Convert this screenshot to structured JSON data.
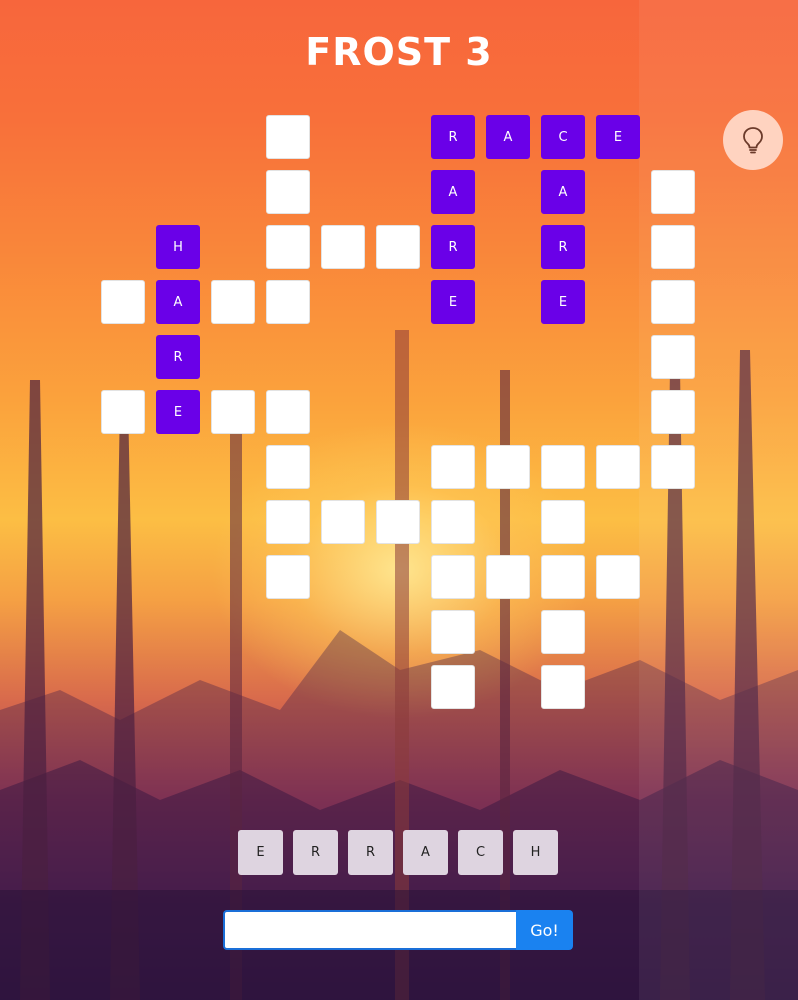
{
  "game": {
    "title": "FROST 3"
  },
  "hint": {
    "icon": "lightbulb-icon"
  },
  "board": {
    "cells": [
      {
        "row": 0,
        "col": 3,
        "letter": ""
      },
      {
        "row": 0,
        "col": 6,
        "letter": "R"
      },
      {
        "row": 0,
        "col": 7,
        "letter": "A"
      },
      {
        "row": 0,
        "col": 8,
        "letter": "C"
      },
      {
        "row": 0,
        "col": 9,
        "letter": "E"
      },
      {
        "row": 1,
        "col": 3,
        "letter": ""
      },
      {
        "row": 1,
        "col": 6,
        "letter": "A"
      },
      {
        "row": 1,
        "col": 8,
        "letter": "A"
      },
      {
        "row": 1,
        "col": 10,
        "letter": ""
      },
      {
        "row": 2,
        "col": 1,
        "letter": "H"
      },
      {
        "row": 2,
        "col": 3,
        "letter": ""
      },
      {
        "row": 2,
        "col": 4,
        "letter": ""
      },
      {
        "row": 2,
        "col": 5,
        "letter": ""
      },
      {
        "row": 2,
        "col": 6,
        "letter": "R"
      },
      {
        "row": 2,
        "col": 8,
        "letter": "R"
      },
      {
        "row": 2,
        "col": 10,
        "letter": ""
      },
      {
        "row": 3,
        "col": 0,
        "letter": ""
      },
      {
        "row": 3,
        "col": 1,
        "letter": "A"
      },
      {
        "row": 3,
        "col": 2,
        "letter": ""
      },
      {
        "row": 3,
        "col": 3,
        "letter": ""
      },
      {
        "row": 3,
        "col": 6,
        "letter": "E"
      },
      {
        "row": 3,
        "col": 8,
        "letter": "E"
      },
      {
        "row": 3,
        "col": 10,
        "letter": ""
      },
      {
        "row": 4,
        "col": 1,
        "letter": "R"
      },
      {
        "row": 4,
        "col": 10,
        "letter": ""
      },
      {
        "row": 5,
        "col": 0,
        "letter": ""
      },
      {
        "row": 5,
        "col": 1,
        "letter": "E"
      },
      {
        "row": 5,
        "col": 2,
        "letter": ""
      },
      {
        "row": 5,
        "col": 3,
        "letter": ""
      },
      {
        "row": 5,
        "col": 10,
        "letter": ""
      },
      {
        "row": 6,
        "col": 3,
        "letter": ""
      },
      {
        "row": 6,
        "col": 6,
        "letter": ""
      },
      {
        "row": 6,
        "col": 7,
        "letter": ""
      },
      {
        "row": 6,
        "col": 8,
        "letter": ""
      },
      {
        "row": 6,
        "col": 9,
        "letter": ""
      },
      {
        "row": 6,
        "col": 10,
        "letter": ""
      },
      {
        "row": 7,
        "col": 3,
        "letter": ""
      },
      {
        "row": 7,
        "col": 4,
        "letter": ""
      },
      {
        "row": 7,
        "col": 5,
        "letter": ""
      },
      {
        "row": 7,
        "col": 6,
        "letter": ""
      },
      {
        "row": 7,
        "col": 8,
        "letter": ""
      },
      {
        "row": 8,
        "col": 3,
        "letter": ""
      },
      {
        "row": 8,
        "col": 6,
        "letter": ""
      },
      {
        "row": 8,
        "col": 7,
        "letter": ""
      },
      {
        "row": 8,
        "col": 8,
        "letter": ""
      },
      {
        "row": 8,
        "col": 9,
        "letter": ""
      },
      {
        "row": 9,
        "col": 6,
        "letter": ""
      },
      {
        "row": 9,
        "col": 8,
        "letter": ""
      },
      {
        "row": 10,
        "col": 6,
        "letter": ""
      },
      {
        "row": 10,
        "col": 8,
        "letter": ""
      }
    ]
  },
  "letter_tiles": [
    "E",
    "R",
    "R",
    "A",
    "C",
    "H"
  ],
  "guess": {
    "value": "",
    "placeholder": "",
    "submit_label": "Go!"
  },
  "colors": {
    "filled_cell": "#6a00e8",
    "empty_cell": "#ffffff",
    "tile": "#ded4e0",
    "submit_button": "#1a82f0"
  }
}
